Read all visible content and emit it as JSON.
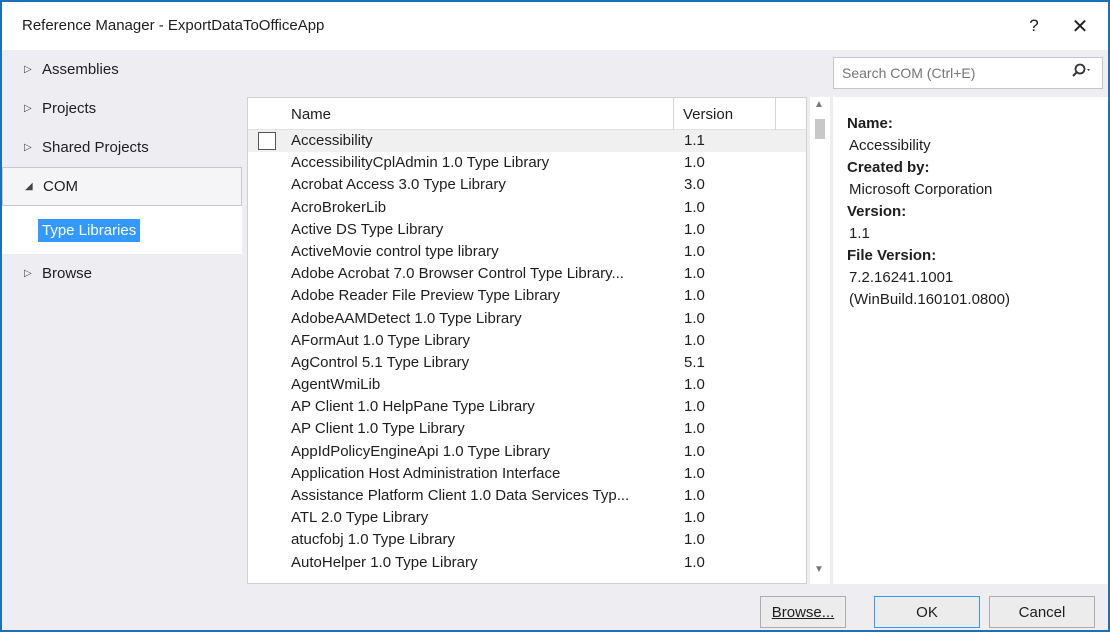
{
  "window": {
    "title": "Reference Manager - ExportDataToOfficeApp",
    "help_label": "?",
    "close_label": "✕"
  },
  "nav": {
    "items": [
      {
        "label": "Assemblies",
        "arrow": "▷"
      },
      {
        "label": "Projects",
        "arrow": "▷"
      },
      {
        "label": "Shared Projects",
        "arrow": "▷"
      },
      {
        "label": "COM",
        "arrow": "◢"
      },
      {
        "label": "Browse",
        "arrow": "▷"
      }
    ],
    "sub_item": "Type Libraries"
  },
  "search": {
    "placeholder": "Search COM (Ctrl+E)",
    "icon": "search-icon",
    "dropdown": "▾"
  },
  "list": {
    "columns": {
      "name": "Name",
      "version": "Version"
    },
    "rows": [
      {
        "name": "Accessibility",
        "version": "1.1"
      },
      {
        "name": "AccessibilityCplAdmin 1.0 Type Library",
        "version": "1.0"
      },
      {
        "name": "Acrobat Access 3.0 Type Library",
        "version": "3.0"
      },
      {
        "name": "AcroBrokerLib",
        "version": "1.0"
      },
      {
        "name": "Active DS Type Library",
        "version": "1.0"
      },
      {
        "name": "ActiveMovie control type library",
        "version": "1.0"
      },
      {
        "name": "Adobe Acrobat 7.0 Browser Control Type Library...",
        "version": "1.0"
      },
      {
        "name": "Adobe Reader File Preview Type Library",
        "version": "1.0"
      },
      {
        "name": "AdobeAAMDetect 1.0 Type Library",
        "version": "1.0"
      },
      {
        "name": "AFormAut 1.0 Type Library",
        "version": "1.0"
      },
      {
        "name": "AgControl 5.1 Type Library",
        "version": "5.1"
      },
      {
        "name": "AgentWmiLib",
        "version": "1.0"
      },
      {
        "name": "AP Client 1.0 HelpPane Type Library",
        "version": "1.0"
      },
      {
        "name": "AP Client 1.0 Type Library",
        "version": "1.0"
      },
      {
        "name": "AppIdPolicyEngineApi 1.0 Type Library",
        "version": "1.0"
      },
      {
        "name": "Application Host Administration Interface",
        "version": "1.0"
      },
      {
        "name": "Assistance Platform Client 1.0 Data Services Typ...",
        "version": "1.0"
      },
      {
        "name": "ATL 2.0 Type Library",
        "version": "1.0"
      },
      {
        "name": "atucfobj 1.0 Type Library",
        "version": "1.0"
      },
      {
        "name": "AutoHelper 1.0 Type Library",
        "version": "1.0"
      }
    ]
  },
  "details": {
    "name_label": "Name:",
    "name_value": "Accessibility",
    "created_label": "Created by:",
    "created_value": "Microsoft Corporation",
    "version_label": "Version:",
    "version_value": "1.1",
    "file_version_label": "File Version:",
    "file_version_value": "7.2.16241.1001",
    "file_version_build": "(WinBuild.160101.0800)"
  },
  "buttons": {
    "browse": "Browse...",
    "ok": "OK",
    "cancel": "Cancel"
  }
}
